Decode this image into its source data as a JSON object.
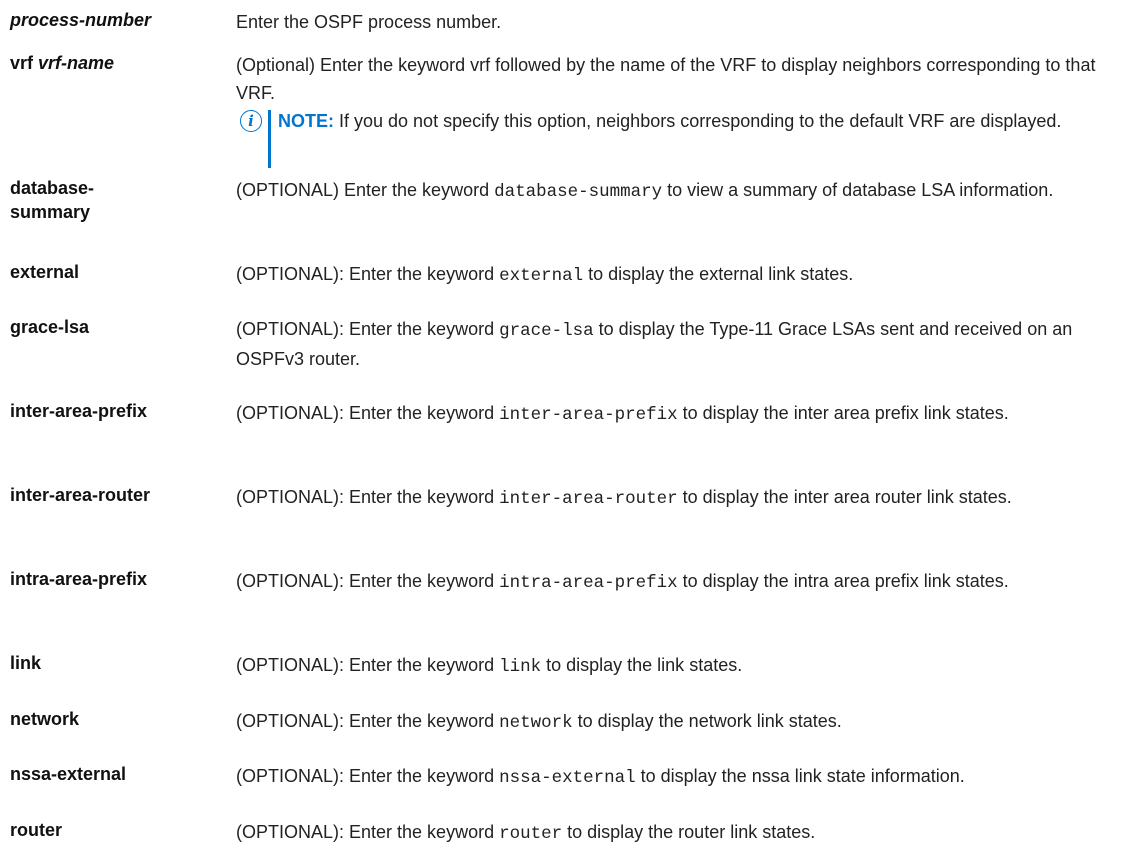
{
  "rows": [
    {
      "term": "process-number",
      "desc": "Enter the OSPF process number."
    },
    {
      "term_kw": "vrf",
      "term_arg": "vrf-name",
      "desc": "(Optional) Enter the keyword vrf followed by the name of the VRF to display neighbors corresponding to that VRF.",
      "note_label": "NOTE:",
      "note_text": " If you do not specify this option, neighbors corresponding to the default VRF are displayed."
    },
    {
      "term": "database-summary",
      "pre": "(OPTIONAL) Enter the keyword ",
      "kw": "database-summary",
      "post": " to view a summary of database LSA information."
    },
    {
      "term": "external",
      "pre": "(OPTIONAL): Enter the keyword ",
      "kw": "external",
      "post": " to display the external link states."
    },
    {
      "term": "grace-lsa",
      "pre": "(OPTIONAL): Enter the keyword ",
      "kw": "grace-lsa",
      "post": " to display the Type-11 Grace LSAs sent and received on an OSPFv3 router."
    },
    {
      "term": "inter-area-prefix",
      "pre": "(OPTIONAL): Enter the keyword ",
      "kw": "inter-area-prefix",
      "post": " to display the inter area prefix link states."
    },
    {
      "term": "inter-area-router",
      "pre": "(OPTIONAL): Enter the keyword ",
      "kw": "inter-area-router",
      "post": " to display the inter area router link states."
    },
    {
      "term": "intra-area-prefix",
      "pre": "(OPTIONAL): Enter the keyword ",
      "kw": "intra-area-prefix",
      "post": " to display the intra area prefix link states."
    },
    {
      "term": "link",
      "pre": "(OPTIONAL): Enter the keyword ",
      "kw": "link",
      "post": " to display the link states."
    },
    {
      "term": "network",
      "pre": "(OPTIONAL): Enter the keyword ",
      "kw": "network",
      "post": " to display the network link states."
    },
    {
      "term": "nssa-external",
      "pre": "(OPTIONAL): Enter the keyword ",
      "kw": "nssa-external",
      "post": " to display the nssa link state information."
    },
    {
      "term": "router",
      "pre": "(OPTIONAL): Enter the keyword ",
      "kw": "router",
      "post": " to display the router link states."
    }
  ],
  "icons": {
    "note": "info-icon"
  },
  "colors": {
    "accent": "#0076CE",
    "text": "#222222"
  }
}
